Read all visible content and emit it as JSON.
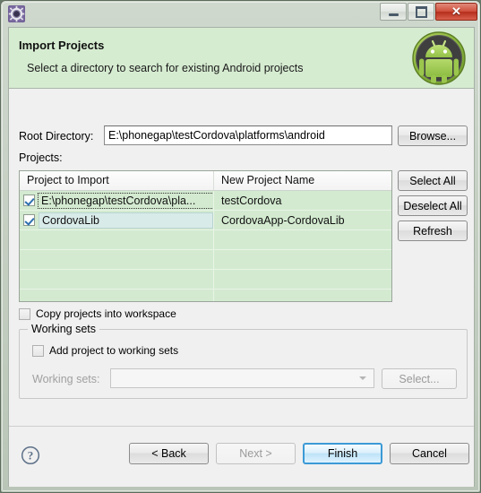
{
  "window": {
    "icon": "eclipse-wizard-gear-icon",
    "controls": {
      "minimize_label": "",
      "restore_label": "",
      "close_label": "✕"
    }
  },
  "banner": {
    "title": "Import Projects",
    "subtitle": "Select a directory to search for existing Android projects",
    "logo": "android-robot-icon",
    "background_color": "#d6ecd1"
  },
  "form": {
    "root_directory_label": "Root Directory:",
    "root_directory_value": "E:\\phonegap\\testCordova\\platforms\\android",
    "root_directory_placeholder": "",
    "browse_label": "Browse...",
    "projects_label": "Projects:"
  },
  "table": {
    "columns": [
      "Project to Import",
      "New Project Name"
    ],
    "rows": [
      {
        "checked": true,
        "project_to_import": "E:\\phonegap\\testCordova\\pla...",
        "new_project_name": "testCordova",
        "focused": true,
        "selected": false
      },
      {
        "checked": true,
        "project_to_import": "CordovaLib",
        "new_project_name": "CordovaApp-CordovaLib",
        "focused": false,
        "selected": true
      }
    ],
    "empty_row_count": 4,
    "row_background_color": "#d3ead0"
  },
  "side_buttons": {
    "select_all_label": "Select All",
    "deselect_all_label": "Deselect All",
    "refresh_label": "Refresh"
  },
  "options": {
    "copy_projects_label": "Copy projects into workspace",
    "copy_projects_checked": false
  },
  "working_sets": {
    "group_label": "Working sets",
    "add_project_label": "Add project to working sets",
    "add_project_checked": false,
    "select_label": "Working sets:",
    "combo_value": "",
    "select_button_label": "Select...",
    "disabled": true
  },
  "footer": {
    "help_icon": "help-question-icon",
    "back_label": "< Back",
    "next_label": "Next >",
    "finish_label": "Finish",
    "cancel_label": "Cancel",
    "next_enabled": false,
    "default_button": "Finish",
    "accent_color": "#3c9ad6"
  }
}
